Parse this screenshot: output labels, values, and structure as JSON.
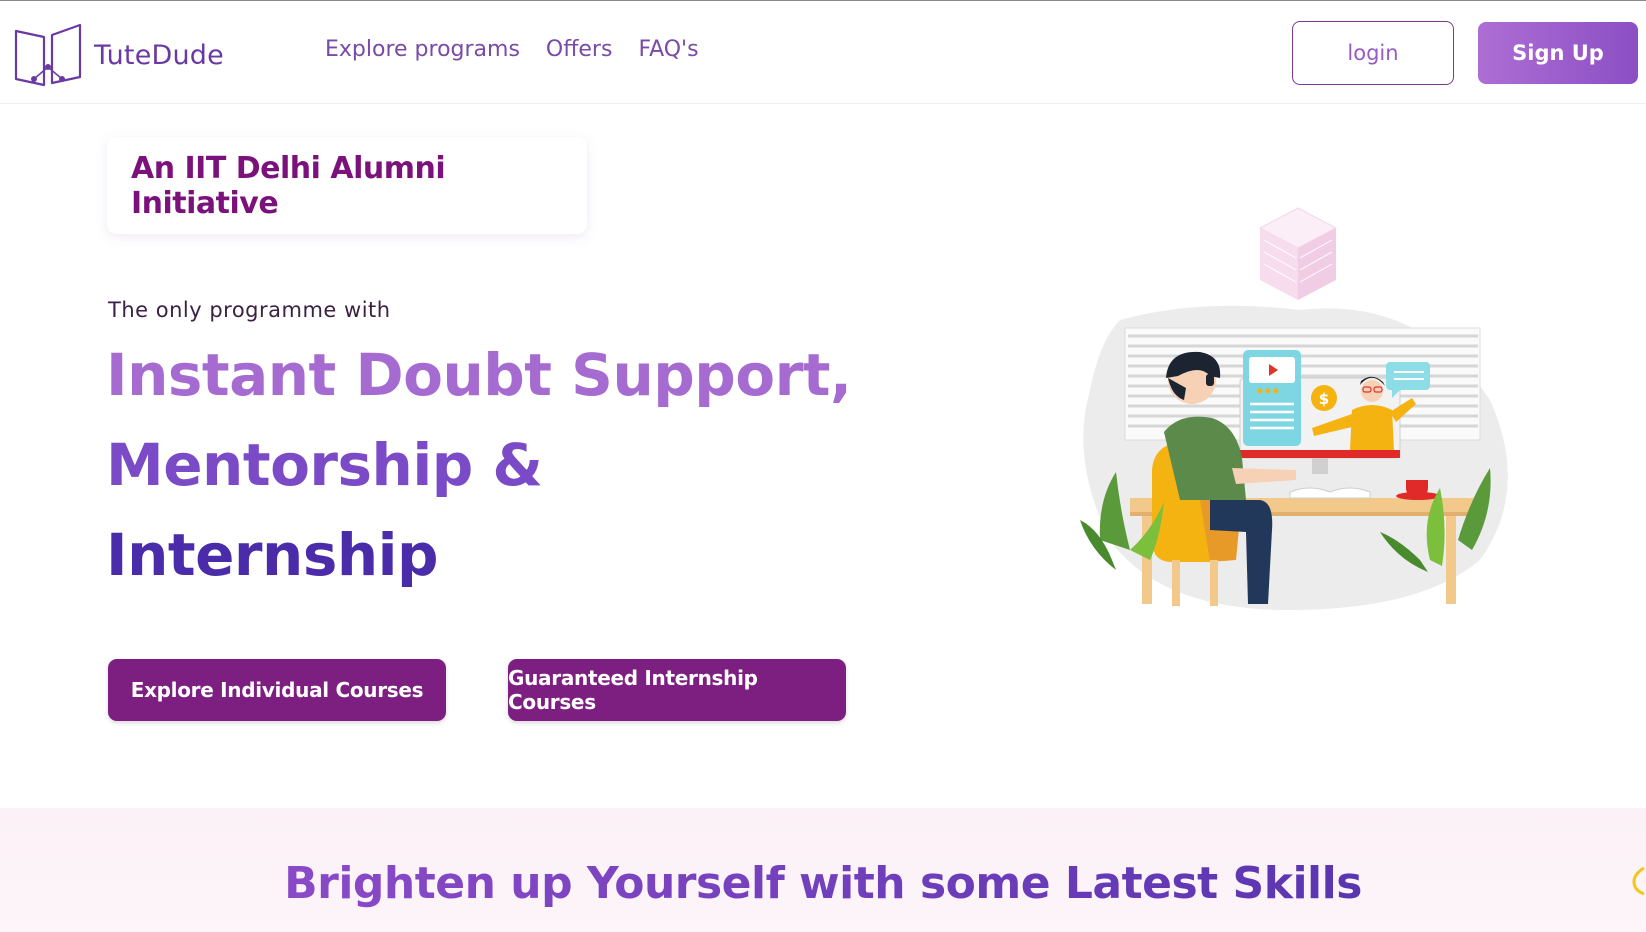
{
  "header": {
    "brand": "TuteDude",
    "nav": [
      {
        "label": "Explore programs"
      },
      {
        "label": "Offers"
      },
      {
        "label": "FAQ's"
      }
    ],
    "login_label": "login",
    "signup_label": "Sign Up"
  },
  "hero": {
    "badge": "An IIT Delhi Alumni Initiative",
    "tagline": "The only programme with",
    "headline_line1": "Instant Doubt Support,",
    "headline_line2": "Mentorship &",
    "headline_line3": "Internship",
    "cta_primary": "Explore Individual Courses",
    "cta_secondary": "Guaranteed Internship Courses"
  },
  "section": {
    "title": "Brighten up Yourself with some Latest Skills"
  },
  "colors": {
    "brand_purple": "#7d1f81",
    "accent_light": "#a66bd0",
    "accent_mid": "#7a4ac7",
    "accent_dark": "#4a2ba9"
  },
  "icons": {
    "logo": "open-book-icon",
    "illustration": "online-mentoring-illustration"
  }
}
